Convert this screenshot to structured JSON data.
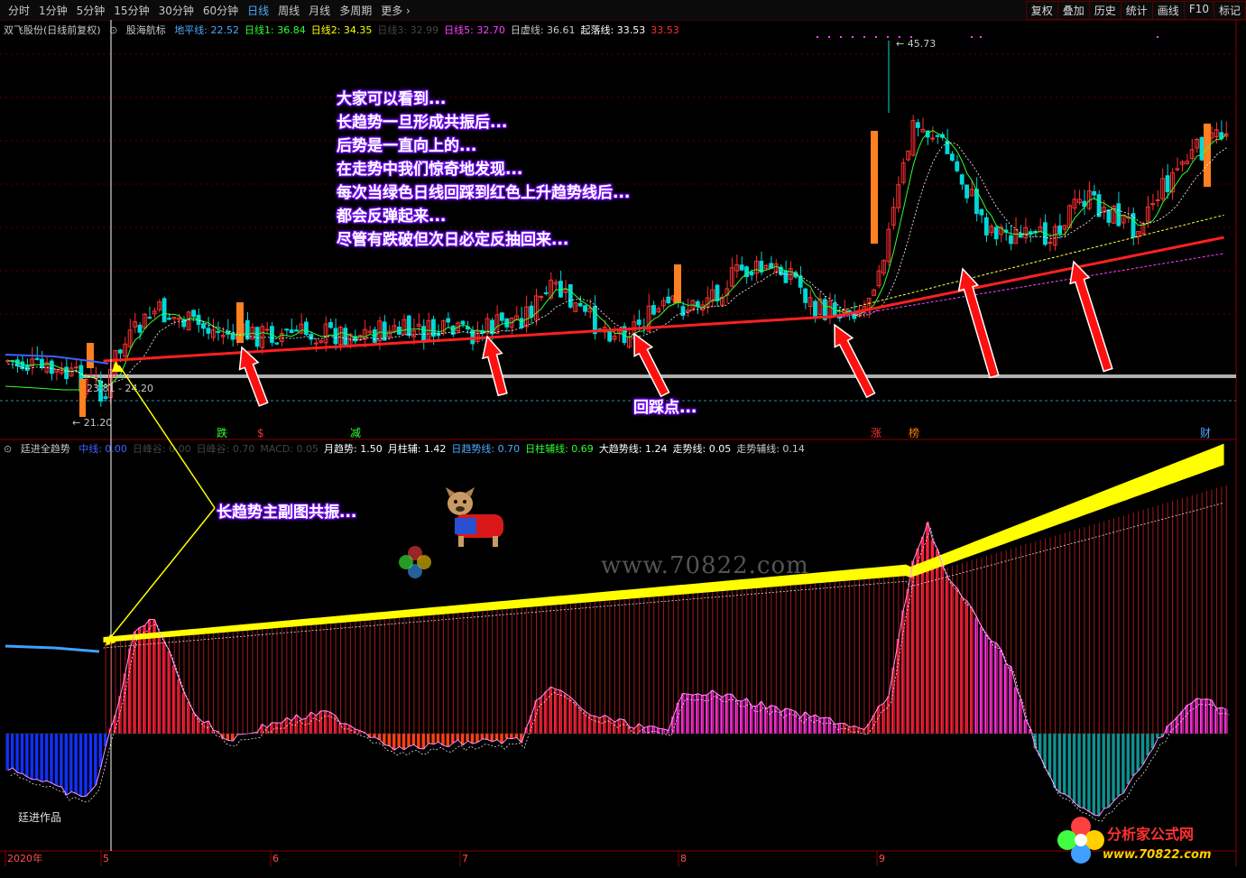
{
  "toolbar": {
    "periods": [
      "分时",
      "1分钟",
      "5分钟",
      "15分钟",
      "30分钟",
      "60分钟",
      "日线",
      "周线",
      "月线",
      "多周期",
      "更多"
    ],
    "active_period": "日线",
    "actions": [
      "复权",
      "叠加",
      "历史",
      "统计",
      "画线",
      "F10",
      "标记"
    ]
  },
  "main_legend": {
    "stock": "双飞股份(日线前复权)",
    "indicator": "股海航标",
    "items": [
      {
        "label": "地平线: 22.52",
        "color": "#4fa8ff"
      },
      {
        "label": "日线1: 36.84",
        "color": "#30ff30"
      },
      {
        "label": "日线2: 34.35",
        "color": "#ffff00"
      },
      {
        "label": "日线3: 32.99",
        "color": "#444444"
      },
      {
        "label": "日线5: 32.70",
        "color": "#ff40ff"
      },
      {
        "label": "日虚线: 36.61",
        "color": "#c8c8c8"
      },
      {
        "label": "起落线: 33.53",
        "color": "#ffffff"
      },
      {
        "label": "33.53",
        "color": "#ff3030"
      }
    ]
  },
  "price_labels": {
    "high": "45.73",
    "low": "21.20",
    "range": "23.81 - 24.20"
  },
  "signals": [
    {
      "text": "跌",
      "color": "#30ff30"
    },
    {
      "text": "$",
      "color": "#ff3030"
    },
    {
      "text": "减",
      "color": "#30ff30"
    },
    {
      "text": "涨",
      "color": "#ff3030"
    },
    {
      "text": "榜",
      "color": "#ff8000"
    },
    {
      "text": "财",
      "color": "#4fa8ff"
    }
  ],
  "annotation_main": [
    "大家可以看到...",
    "长趋势一旦形成共振后...",
    "后势是一直向上的...",
    "在走势中我们惊奇地发现...",
    "每次当绿色日线回踩到红色上升趋势线后...",
    "都会反弹起来...",
    "尽管有跌破但次日必定反抽回来..."
  ],
  "annotation_pullback": "回踩点...",
  "annotation_resonance": "长趋势主副图共振...",
  "sub_legend": {
    "indicator": "廷进全趋势",
    "items": [
      {
        "label": "中线: 0.00",
        "color": "#4060ff"
      },
      {
        "label": "日峰谷: 0.00",
        "color": "#444444"
      },
      {
        "label": "日峰谷: 0.70",
        "color": "#444444"
      },
      {
        "label": "MACD: 0.05",
        "color": "#444444"
      },
      {
        "label": "月趋势: 1.50",
        "color": "#ffffff"
      },
      {
        "label": "月柱辅: 1.42",
        "color": "#ffffff"
      },
      {
        "label": "日趋势线: 0.70",
        "color": "#4fa8ff"
      },
      {
        "label": "日柱辅线: 0.69",
        "color": "#30ff30"
      },
      {
        "label": "大趋势线: 1.24",
        "color": "#ffffff"
      },
      {
        "label": "走势线: 0.05",
        "color": "#ffffff"
      },
      {
        "label": "走势辅线: 0.14",
        "color": "#c8c8c8"
      }
    ]
  },
  "author_label": "廷进作品",
  "watermark_center": "www.70822.com",
  "watermark_logo": "分析家公式网",
  "watermark_logo_url": "www.70822.com",
  "x_axis": [
    "2020年",
    "5",
    "6",
    "7",
    "8",
    "9"
  ]
}
